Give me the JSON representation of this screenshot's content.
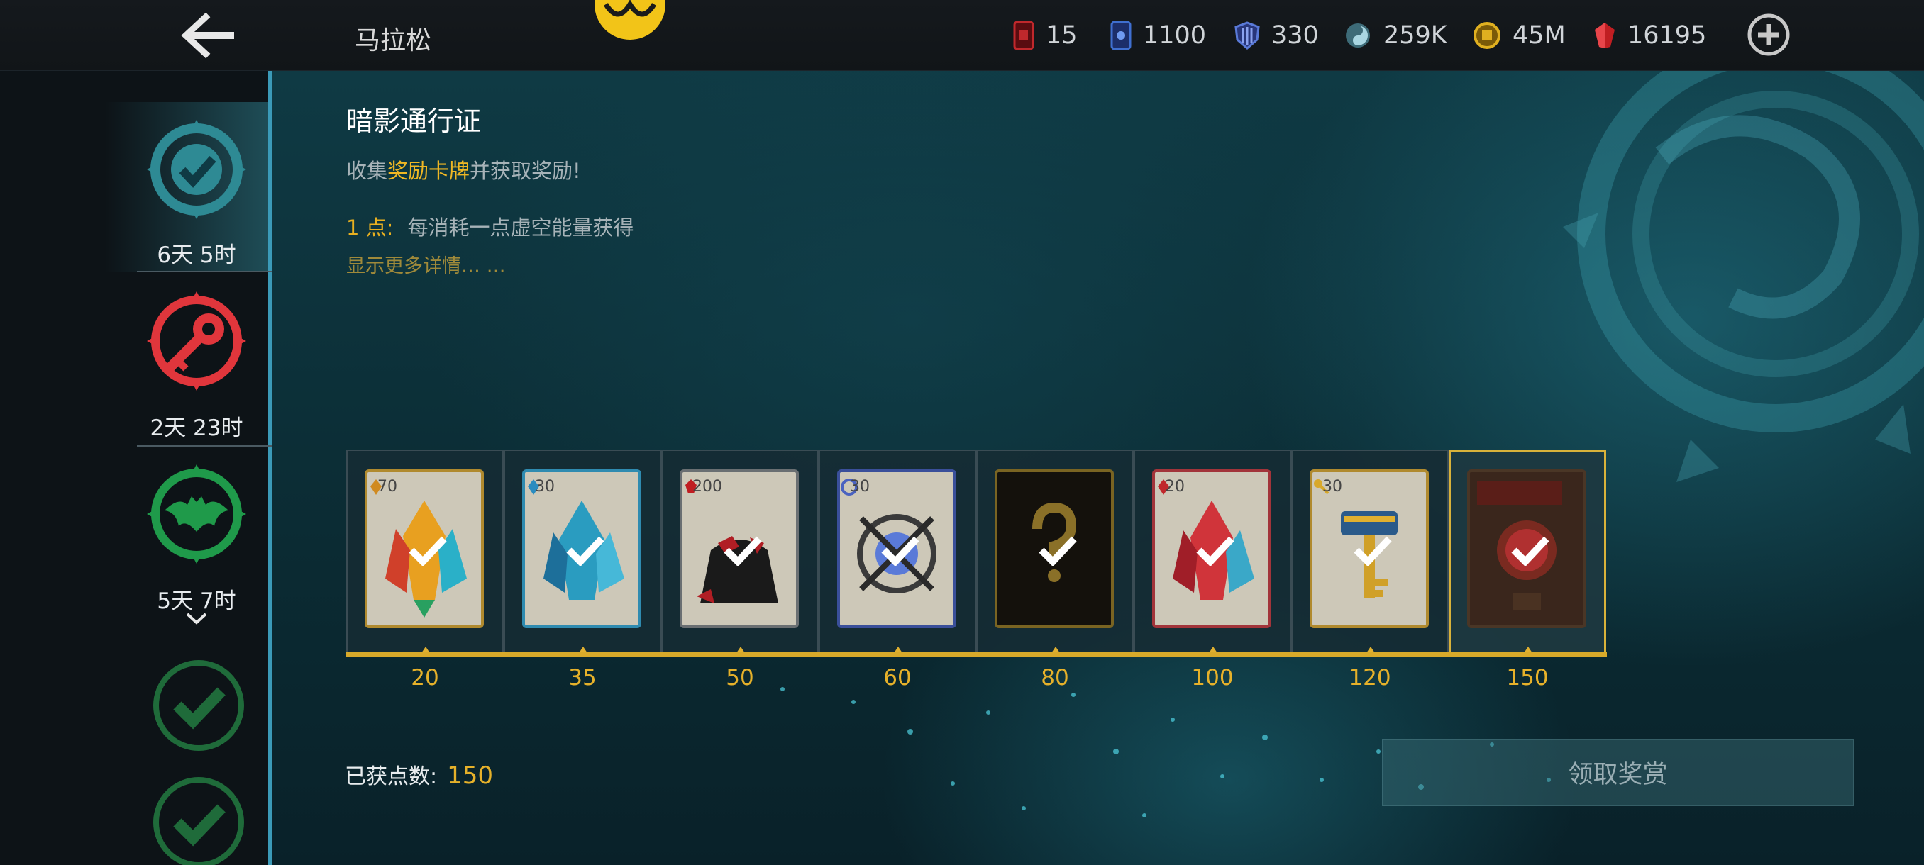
{
  "header": {
    "mode_title": "马拉松",
    "currencies": [
      {
        "icon": "red-ticket-icon",
        "value": "15",
        "color": "#c0282c"
      },
      {
        "icon": "blue-card-icon",
        "value": "1100",
        "color": "#3f6fd0"
      },
      {
        "icon": "shield-emblem-icon",
        "value": "330",
        "color": "#5a7ad8"
      },
      {
        "icon": "swirl-orb-icon",
        "value": "259K",
        "color": "#7fb6c8"
      },
      {
        "icon": "gold-coin-icon",
        "value": "45M",
        "color": "#e0b020"
      },
      {
        "icon": "ruby-gem-icon",
        "value": "16195",
        "color": "#d02a2a"
      }
    ]
  },
  "sidebar": {
    "items": [
      {
        "icon": "teal-check-badge-icon",
        "label": "6天 5时",
        "color": "#2e8a94"
      },
      {
        "icon": "red-key-badge-icon",
        "label": "2天 23时",
        "color": "#e0363c"
      },
      {
        "icon": "green-bat-badge-icon",
        "label": "5天 7时",
        "color": "#1f9a4a"
      },
      {
        "icon": "green-check-badge-icon",
        "label": "",
        "color": "#1f6b3a"
      },
      {
        "icon": "green-check-badge-icon",
        "label": "",
        "color": "#1f6b3a"
      }
    ]
  },
  "pass": {
    "title": "暗影通行证",
    "subtitle_prefix": "收集",
    "subtitle_highlight": "奖励卡牌",
    "subtitle_suffix": "并获取奖励!",
    "point_label": "1 点:",
    "point_text": "每消耗一点虚空能量获得",
    "more_link": "显示更多详情… …"
  },
  "rewards": [
    {
      "milestone": "20",
      "cost": "70",
      "item": "rainbow-crystal",
      "claimed": true
    },
    {
      "milestone": "35",
      "cost": "30",
      "item": "blue-crystal",
      "claimed": true
    },
    {
      "milestone": "50",
      "cost": "200",
      "item": "ruby-pouch",
      "claimed": true
    },
    {
      "milestone": "60",
      "cost": "30",
      "item": "emblem-shield",
      "claimed": true
    },
    {
      "milestone": "80",
      "cost": "",
      "item": "mystery-card",
      "claimed": true
    },
    {
      "milestone": "100",
      "cost": "20",
      "item": "red-crystal",
      "claimed": true
    },
    {
      "milestone": "120",
      "cost": "30",
      "item": "golden-key",
      "claimed": true
    },
    {
      "milestone": "150",
      "cost": "",
      "item": "poster-card",
      "claimed": true,
      "selected": true
    }
  ],
  "footer": {
    "earned_label": "已获点数:",
    "earned_value": "150",
    "claim_button": "领取奖赏"
  },
  "colors": {
    "accent_gold": "#e6b12a",
    "track_blue": "#3b9ab8",
    "background_teal": "#0f3a44"
  }
}
